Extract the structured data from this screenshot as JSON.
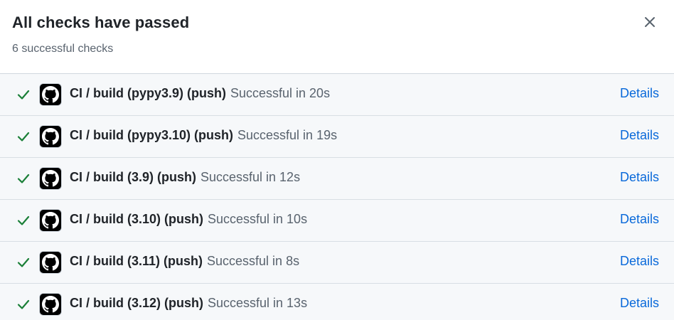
{
  "header": {
    "title": "All checks have passed",
    "subtitle": "6 successful checks"
  },
  "icons": {
    "close": "close-icon",
    "check": "check-icon",
    "avatar": "github-icon"
  },
  "colors": {
    "success": "#1a7f37",
    "link": "#0969da",
    "row_background": "#f6f8fa"
  },
  "checks": [
    {
      "name": "CI / build (pypy3.9) (push)",
      "status": "Successful in 20s",
      "details_label": "Details"
    },
    {
      "name": "CI / build (pypy3.10) (push)",
      "status": "Successful in 19s",
      "details_label": "Details"
    },
    {
      "name": "CI / build (3.9) (push)",
      "status": "Successful in 12s",
      "details_label": "Details"
    },
    {
      "name": "CI / build (3.10) (push)",
      "status": "Successful in 10s",
      "details_label": "Details"
    },
    {
      "name": "CI / build (3.11) (push)",
      "status": "Successful in 8s",
      "details_label": "Details"
    },
    {
      "name": "CI / build (3.12) (push)",
      "status": "Successful in 13s",
      "details_label": "Details"
    }
  ]
}
